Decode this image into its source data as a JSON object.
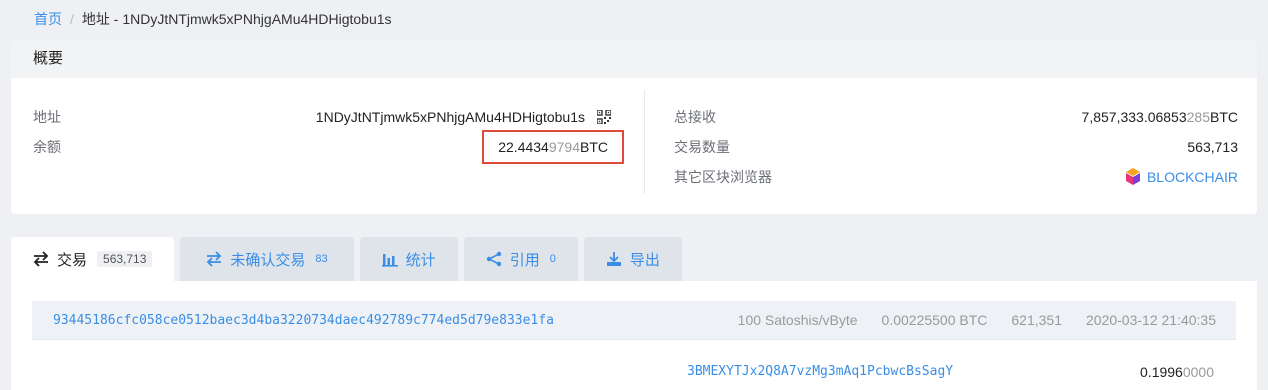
{
  "breadcrumb": {
    "home": "首页",
    "separator": "/",
    "current": "地址 - 1NDyJtNTjmwk5xPNhjgAMu4HDHigtobu1s"
  },
  "summary": {
    "title": "概要",
    "address_label": "地址",
    "address_value": "1NDyJtNTjmwk5xPNhjgAMu4HDHigtobu1s",
    "balance_label": "余额",
    "balance_main": "22.4434",
    "balance_dim": "9794",
    "balance_unit": " BTC",
    "total_received_label": "总接收",
    "total_received_main": "7,857,333.06853",
    "total_received_dim": "285",
    "total_received_unit": " BTC",
    "tx_count_label": "交易数量",
    "tx_count_value": "563,713",
    "other_explorers_label": "其它区块浏览器",
    "other_explorers_link": "BLOCKCHAIR"
  },
  "tabs": [
    {
      "label": "交易",
      "count": "563,713",
      "icon": "transfer-icon"
    },
    {
      "label": "未确认交易",
      "count": "83",
      "icon": "transfer-icon"
    },
    {
      "label": "统计",
      "count": "",
      "icon": "bar-chart-icon"
    },
    {
      "label": "引用",
      "count": "0",
      "icon": "share-icon"
    },
    {
      "label": "导出",
      "count": "",
      "icon": "download-icon"
    }
  ],
  "transaction": {
    "hash": "93445186cfc058ce0512baec3d4ba3220734daec492789c774ed5d79e833e1fa",
    "fee_rate": "100 Satoshis/vByte",
    "fee": "0.00225500 BTC",
    "block": "621,351",
    "time": "2020-03-12 21:40:35",
    "output_address": "3BMEXYTJx2Q8A7vzMg3mAq1PcbwcBsSagY",
    "output_amount_main": "0.1996",
    "output_amount_dim": "0000"
  },
  "colors": {
    "accent": "#3a8ee6",
    "highlight_border": "#e04a3a",
    "background": "#eef0f4"
  }
}
